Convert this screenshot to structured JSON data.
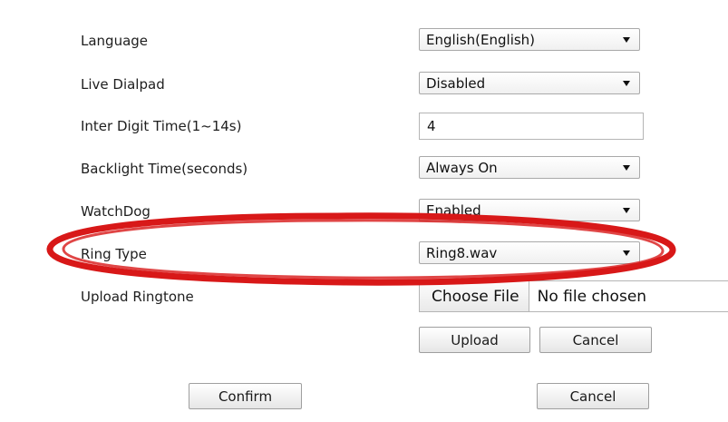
{
  "settings": {
    "language": {
      "label": "Language",
      "value": "English(English)"
    },
    "live_dialpad": {
      "label": "Live Dialpad",
      "value": "Disabled"
    },
    "inter_digit_time": {
      "label": "Inter Digit Time(1~14s)",
      "value": "4"
    },
    "backlight_time": {
      "label": "Backlight Time(seconds)",
      "value": "Always On"
    },
    "watchdog": {
      "label": "WatchDog",
      "value": "Enabled"
    },
    "ring_type": {
      "label": "Ring Type",
      "value": "Ring8.wav"
    },
    "upload_ringtone": {
      "label": "Upload Ringtone",
      "choose_label": "Choose File",
      "file_status": "No file chosen",
      "upload_label": "Upload",
      "cancel_label": "Cancel"
    }
  },
  "footer": {
    "confirm_label": "Confirm",
    "cancel_label": "Cancel"
  },
  "colors": {
    "highlight_ellipse": "#d81818"
  },
  "icons": {
    "dropdown": "triangle-down"
  }
}
